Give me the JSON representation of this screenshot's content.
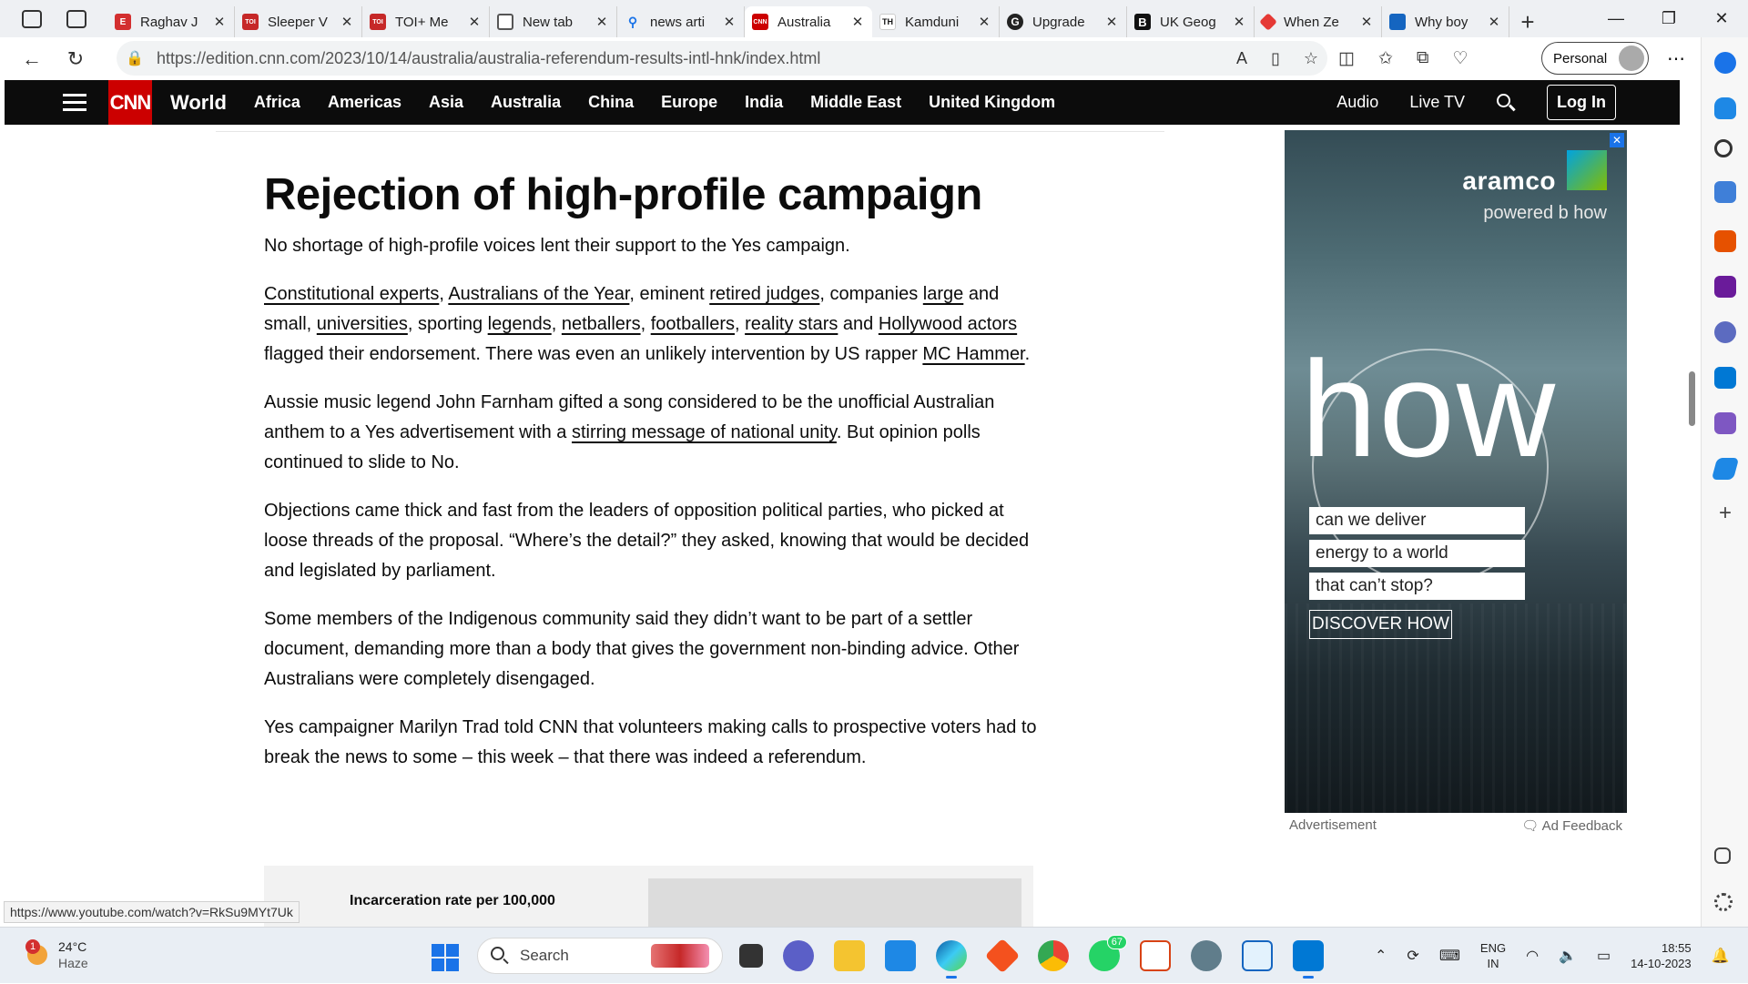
{
  "browser": {
    "tabs": [
      {
        "title": "Raghav J",
        "favicon": "E",
        "color": "#d32f2f"
      },
      {
        "title": "Sleeper V",
        "favicon": "TOI",
        "color": "#c62828"
      },
      {
        "title": "TOI+ Me",
        "favicon": "TOI",
        "color": "#c62828"
      },
      {
        "title": "New tab",
        "favicon": "",
        "color": "#555555"
      },
      {
        "title": "news arti",
        "favicon": "",
        "color": "#1a73e8"
      },
      {
        "title": "Australia",
        "favicon": "CNN",
        "color": "#cc0000"
      },
      {
        "title": "Kamduni",
        "favicon": "TH",
        "color": "#ffffff"
      },
      {
        "title": "Upgrade",
        "favicon": "G",
        "color": "#222222"
      },
      {
        "title": "UK Geog",
        "favicon": "B",
        "color": "#111111"
      },
      {
        "title": "When Ze",
        "favicon": "",
        "color": "#e53935"
      },
      {
        "title": "Why boy",
        "favicon": "",
        "color": "#1565c0"
      }
    ],
    "url": "https://edition.cnn.com/2023/10/14/australia/australia-referendum-results-intl-hnk/index.html",
    "profile_label": "Personal",
    "status_url": "https://www.youtube.com/watch?v=RkSu9MYt7Uk"
  },
  "cnn_nav": {
    "logo": "CNN",
    "section": "World",
    "items": [
      "Africa",
      "Americas",
      "Asia",
      "Australia",
      "China",
      "Europe",
      "India",
      "Middle East",
      "United Kingdom"
    ],
    "audio": "Audio",
    "live_tv": "Live TV",
    "login": "Log In"
  },
  "article": {
    "headline": "Rejection of high-profile campaign",
    "intro": "No shortage of high-profile voices lent their support to the Yes campaign.",
    "p2": {
      "l1": "Constitutional experts",
      "t1": ", ",
      "l2": "Australians of the Year",
      "t2": ", eminent ",
      "l3": "retired judges",
      "t3": ", companies ",
      "l4": "large",
      "t4": " and small, ",
      "l5": "universities",
      "t5": ", sporting ",
      "l6": "legends",
      "t6": ", ",
      "l7": "netballers",
      "t7": ", ",
      "l8": "footballers",
      "t8": ", ",
      "l9": "reality stars",
      "t9": " and ",
      "l10": "Hollywood actors",
      "t10": " flagged their endorsement. There was even an unlikely intervention by US rapper ",
      "l11": "MC Hammer",
      "t11": "."
    },
    "p3": {
      "t1": "Aussie music legend John Farnham gifted a song considered to be the unofficial Australian anthem to a Yes advertisement with a ",
      "l1": "stirring message of national unity",
      "t2": ". But opinion polls continued to slide to No."
    },
    "p4": "Objections came thick and fast from the leaders of opposition political parties, who picked at loose threads of the proposal. “Where’s the detail?” they asked, knowing that would be decided and legislated by parliament.",
    "p5": "Some members of the Indigenous community said they didn’t want to be part of a settler document, demanding more than a body that gives the government non-binding advice. Other Australians were completely disengaged.",
    "p6": "Yes campaigner Marilyn Trad told CNN that volunteers making calls to prospective voters had to break the news to some – this week – that there was indeed a referendum.",
    "chart_title": "Incarceration rate per 100,000"
  },
  "ad": {
    "brand": "aramco",
    "powered": "powered b how",
    "big_word": "how",
    "lines": [
      "can we deliver",
      "energy to a world",
      "that can’t stop?"
    ],
    "cta": "DISCOVER HOW",
    "label": "Advertisement",
    "feedback": "Ad Feedback"
  },
  "taskbar": {
    "weather_temp": "24°C",
    "weather_desc": "Haze",
    "weather_badge": "1",
    "search_placeholder": "Search",
    "whatsapp_badge": "67",
    "lang_top": "ENG",
    "lang_bottom": "IN",
    "time": "18:55",
    "date": "14-10-2023"
  }
}
